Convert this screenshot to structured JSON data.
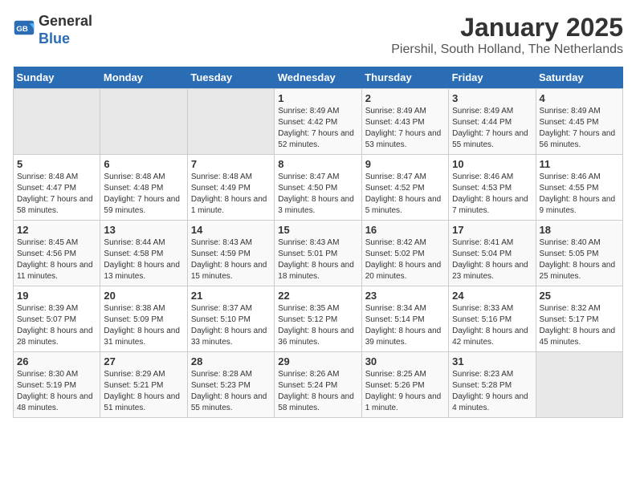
{
  "logo": {
    "text_general": "General",
    "text_blue": "Blue"
  },
  "header": {
    "title": "January 2025",
    "subtitle": "Piershil, South Holland, The Netherlands"
  },
  "days_of_week": [
    "Sunday",
    "Monday",
    "Tuesday",
    "Wednesday",
    "Thursday",
    "Friday",
    "Saturday"
  ],
  "weeks": [
    {
      "days": [
        {
          "num": "",
          "info": "",
          "empty": true
        },
        {
          "num": "",
          "info": "",
          "empty": true
        },
        {
          "num": "",
          "info": "",
          "empty": true
        },
        {
          "num": "1",
          "info": "Sunrise: 8:49 AM\nSunset: 4:42 PM\nDaylight: 7 hours and 52 minutes."
        },
        {
          "num": "2",
          "info": "Sunrise: 8:49 AM\nSunset: 4:43 PM\nDaylight: 7 hours and 53 minutes."
        },
        {
          "num": "3",
          "info": "Sunrise: 8:49 AM\nSunset: 4:44 PM\nDaylight: 7 hours and 55 minutes."
        },
        {
          "num": "4",
          "info": "Sunrise: 8:49 AM\nSunset: 4:45 PM\nDaylight: 7 hours and 56 minutes."
        }
      ]
    },
    {
      "days": [
        {
          "num": "5",
          "info": "Sunrise: 8:48 AM\nSunset: 4:47 PM\nDaylight: 7 hours and 58 minutes."
        },
        {
          "num": "6",
          "info": "Sunrise: 8:48 AM\nSunset: 4:48 PM\nDaylight: 7 hours and 59 minutes."
        },
        {
          "num": "7",
          "info": "Sunrise: 8:48 AM\nSunset: 4:49 PM\nDaylight: 8 hours and 1 minute."
        },
        {
          "num": "8",
          "info": "Sunrise: 8:47 AM\nSunset: 4:50 PM\nDaylight: 8 hours and 3 minutes."
        },
        {
          "num": "9",
          "info": "Sunrise: 8:47 AM\nSunset: 4:52 PM\nDaylight: 8 hours and 5 minutes."
        },
        {
          "num": "10",
          "info": "Sunrise: 8:46 AM\nSunset: 4:53 PM\nDaylight: 8 hours and 7 minutes."
        },
        {
          "num": "11",
          "info": "Sunrise: 8:46 AM\nSunset: 4:55 PM\nDaylight: 8 hours and 9 minutes."
        }
      ]
    },
    {
      "days": [
        {
          "num": "12",
          "info": "Sunrise: 8:45 AM\nSunset: 4:56 PM\nDaylight: 8 hours and 11 minutes."
        },
        {
          "num": "13",
          "info": "Sunrise: 8:44 AM\nSunset: 4:58 PM\nDaylight: 8 hours and 13 minutes."
        },
        {
          "num": "14",
          "info": "Sunrise: 8:43 AM\nSunset: 4:59 PM\nDaylight: 8 hours and 15 minutes."
        },
        {
          "num": "15",
          "info": "Sunrise: 8:43 AM\nSunset: 5:01 PM\nDaylight: 8 hours and 18 minutes."
        },
        {
          "num": "16",
          "info": "Sunrise: 8:42 AM\nSunset: 5:02 PM\nDaylight: 8 hours and 20 minutes."
        },
        {
          "num": "17",
          "info": "Sunrise: 8:41 AM\nSunset: 5:04 PM\nDaylight: 8 hours and 23 minutes."
        },
        {
          "num": "18",
          "info": "Sunrise: 8:40 AM\nSunset: 5:05 PM\nDaylight: 8 hours and 25 minutes."
        }
      ]
    },
    {
      "days": [
        {
          "num": "19",
          "info": "Sunrise: 8:39 AM\nSunset: 5:07 PM\nDaylight: 8 hours and 28 minutes."
        },
        {
          "num": "20",
          "info": "Sunrise: 8:38 AM\nSunset: 5:09 PM\nDaylight: 8 hours and 31 minutes."
        },
        {
          "num": "21",
          "info": "Sunrise: 8:37 AM\nSunset: 5:10 PM\nDaylight: 8 hours and 33 minutes."
        },
        {
          "num": "22",
          "info": "Sunrise: 8:35 AM\nSunset: 5:12 PM\nDaylight: 8 hours and 36 minutes."
        },
        {
          "num": "23",
          "info": "Sunrise: 8:34 AM\nSunset: 5:14 PM\nDaylight: 8 hours and 39 minutes."
        },
        {
          "num": "24",
          "info": "Sunrise: 8:33 AM\nSunset: 5:16 PM\nDaylight: 8 hours and 42 minutes."
        },
        {
          "num": "25",
          "info": "Sunrise: 8:32 AM\nSunset: 5:17 PM\nDaylight: 8 hours and 45 minutes."
        }
      ]
    },
    {
      "days": [
        {
          "num": "26",
          "info": "Sunrise: 8:30 AM\nSunset: 5:19 PM\nDaylight: 8 hours and 48 minutes."
        },
        {
          "num": "27",
          "info": "Sunrise: 8:29 AM\nSunset: 5:21 PM\nDaylight: 8 hours and 51 minutes."
        },
        {
          "num": "28",
          "info": "Sunrise: 8:28 AM\nSunset: 5:23 PM\nDaylight: 8 hours and 55 minutes."
        },
        {
          "num": "29",
          "info": "Sunrise: 8:26 AM\nSunset: 5:24 PM\nDaylight: 8 hours and 58 minutes."
        },
        {
          "num": "30",
          "info": "Sunrise: 8:25 AM\nSunset: 5:26 PM\nDaylight: 9 hours and 1 minute."
        },
        {
          "num": "31",
          "info": "Sunrise: 8:23 AM\nSunset: 5:28 PM\nDaylight: 9 hours and 4 minutes."
        },
        {
          "num": "",
          "info": "",
          "empty": true
        }
      ]
    }
  ]
}
